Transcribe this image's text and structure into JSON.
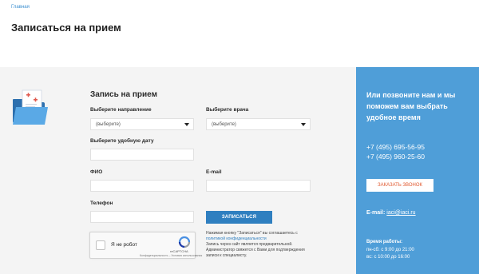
{
  "breadcrumb": "Главная",
  "page_title": "Записаться на прием",
  "form": {
    "title": "Запись на прием",
    "direction_label": "Выберите направление",
    "direction_value": "(выберите)",
    "doctor_label": "Выберите врача",
    "doctor_value": "(выберите)",
    "date_label": "Выберите удобную дату",
    "date_value": "",
    "fio_label": "ФИО",
    "fio_value": "",
    "email_label": "E-mail",
    "email_value": "",
    "phone_label": "Телефон",
    "phone_value": "",
    "submit_label": "ЗАПИСАТЬСЯ"
  },
  "captcha": {
    "label": "Я не робот",
    "brand": "reCAPTCHA",
    "links": "Конфиденциальность – Условия использования"
  },
  "disclaimer": {
    "part1": "Нажимая кнопку \"Записаться\" вы соглашаетесь с ",
    "link": "политикой конфиденциальности",
    "part2": "Запись через сайт является предварительной. Администратор свяжется с Вами для подтверждения записи к специалисту."
  },
  "right_panel": {
    "heading": "Или позвоните нам и мы поможем вам выбрать удобное время",
    "phones": [
      "+7 (495) 695-56-95",
      "+7 (495) 960-25-60"
    ],
    "callback_label": "ЗАКАЗАТЬ ЗВОНОК",
    "email_label": "E-mail:",
    "email_value": "iaci@iaci.ru",
    "hours_title": "Время работы:",
    "hours": [
      "пн-сб: с 9:00 до 21:00",
      "вс: с 10:00 до 16:00"
    ]
  },
  "colors": {
    "accent_blue": "#4f9ed8",
    "button_blue": "#2f7fc0",
    "callback_text": "#e0582e",
    "band_bg": "#f4f4f4"
  },
  "icons": [
    "folder-medical-icon",
    "chevron-down-icon",
    "recaptcha-icon"
  ]
}
